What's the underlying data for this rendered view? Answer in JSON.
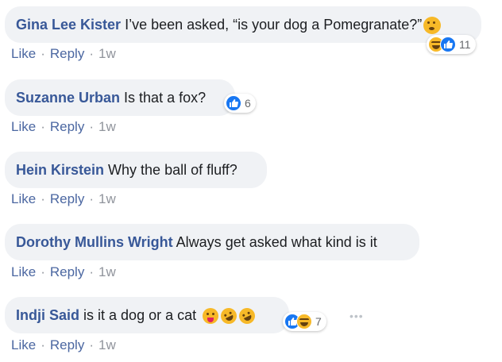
{
  "actions": {
    "like": "Like",
    "reply": "Reply",
    "separator": "·",
    "time": "1w"
  },
  "more_label": "•••",
  "comments": [
    {
      "author": "Gina Lee Kister",
      "text": "I’ve been asked, “is your dog a Pomegranate?”",
      "emoji": "flushed-emoji",
      "reactions": [
        "haha",
        "like"
      ],
      "reaction_count": "11"
    },
    {
      "author": "Suzanne Urban",
      "text": "Is that a fox?",
      "reactions": [
        "like"
      ],
      "reaction_count": "6"
    },
    {
      "author": "Hein Kirstein",
      "text": "Why the ball of fluff?"
    },
    {
      "author": "Dorothy Mullins Wright",
      "text": "Always get asked what kind is it"
    },
    {
      "author": "Indji Said",
      "text": "is it a dog or a cat",
      "emoji": [
        "tongue-emoji",
        "rofl-emoji",
        "rofl-emoji"
      ],
      "reactions": [
        "like",
        "haha"
      ],
      "reaction_count": "7"
    }
  ],
  "colors": {
    "author": "#385898",
    "bubble": "#f0f2f5",
    "action": "#4b67a1",
    "like": "#1877f2",
    "haha": "#f7b928"
  }
}
